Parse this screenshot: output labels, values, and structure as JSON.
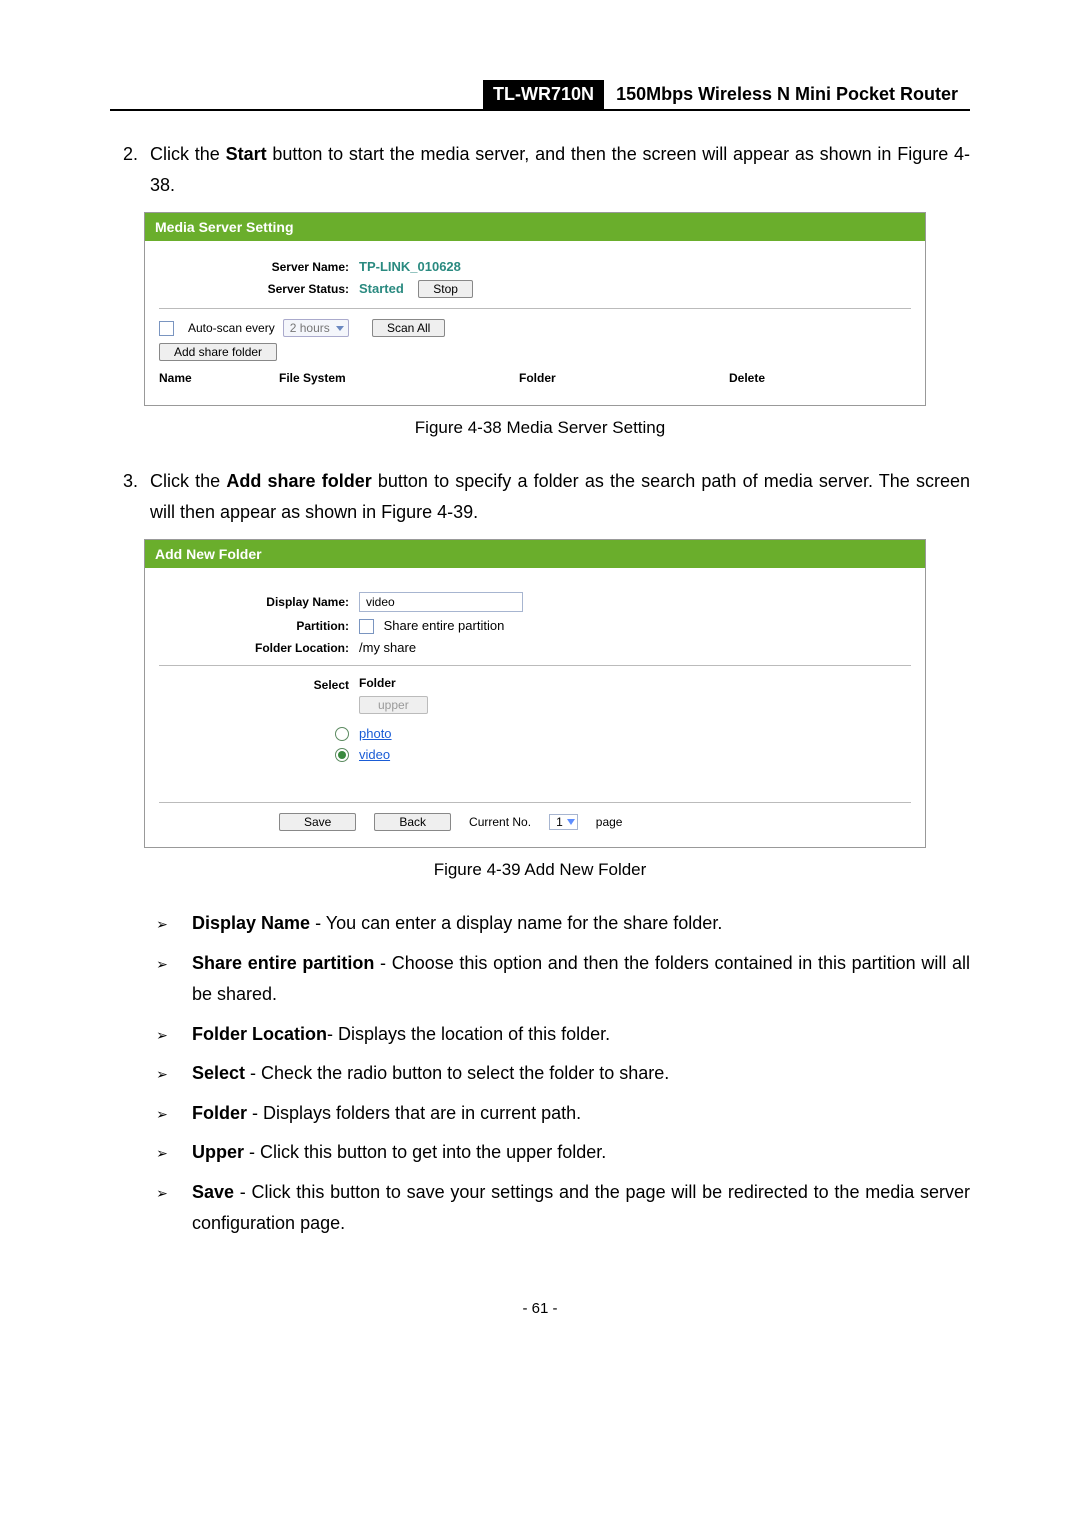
{
  "header": {
    "model": "TL-WR710N",
    "desc": "150Mbps Wireless N Mini Pocket Router"
  },
  "step2": {
    "num": "2.",
    "t1": "Click the ",
    "bold": "Start",
    "t2": " button to start the media server, and then the screen will appear as shown in Figure 4-38."
  },
  "panelA": {
    "title": "Media Server Setting",
    "serverNameLabel": "Server Name:",
    "serverName": "TP-LINK_010628",
    "serverStatusLabel": "Server Status:",
    "serverStatus": "Started",
    "stopBtn": "Stop",
    "autoScanLabel": "Auto-scan every",
    "autoScanValue": "2 hours",
    "scanAllBtn": "Scan All",
    "addShareBtn": "Add share folder",
    "cols": {
      "name": "Name",
      "fs": "File System",
      "folder": "Folder",
      "delete": "Delete"
    }
  },
  "captionA": "Figure 4-38 Media Server Setting",
  "step3": {
    "num": "3.",
    "t1": "Click the ",
    "bold": "Add share folder",
    "t2": " button to specify a folder as the search path of media server. The screen will then appear as shown in Figure 4-39."
  },
  "panelB": {
    "title": "Add New Folder",
    "displayNameLabel": "Display Name:",
    "displayNameValue": "video",
    "partitionLabel": "Partition:",
    "partitionOpt": "Share entire partition",
    "folderLocLabel": "Folder Location:",
    "folderLoc": "/my share",
    "selectLabel": "Select",
    "folderHead": "Folder",
    "upperBtn": "upper",
    "folders": [
      "photo",
      "video"
    ],
    "saveBtn": "Save",
    "backBtn": "Back",
    "currentNoLabel": "Current No.",
    "pageValue": "1",
    "pageSuffix": "page"
  },
  "captionB": "Figure 4-39 Add New Folder",
  "bullets": [
    {
      "bold": "Display Name",
      "rest": " - You can enter a display name for the share folder."
    },
    {
      "bold": "Share entire partition",
      "rest": " - Choose this option and then the folders contained in this partition will all be shared."
    },
    {
      "bold": "Folder Location",
      "rest": "- Displays the location of this folder."
    },
    {
      "bold": "Select",
      "rest": " - Check the radio button to select the folder to share."
    },
    {
      "bold": "Folder",
      "rest": " - Displays folders that are in current path."
    },
    {
      "bold": "Upper",
      "rest": " - Click this button to get into the upper folder."
    },
    {
      "bold": "Save",
      "rest": " - Click this button to save your settings and the page will be redirected to the media server configuration page."
    }
  ],
  "footer": "- 61 -"
}
